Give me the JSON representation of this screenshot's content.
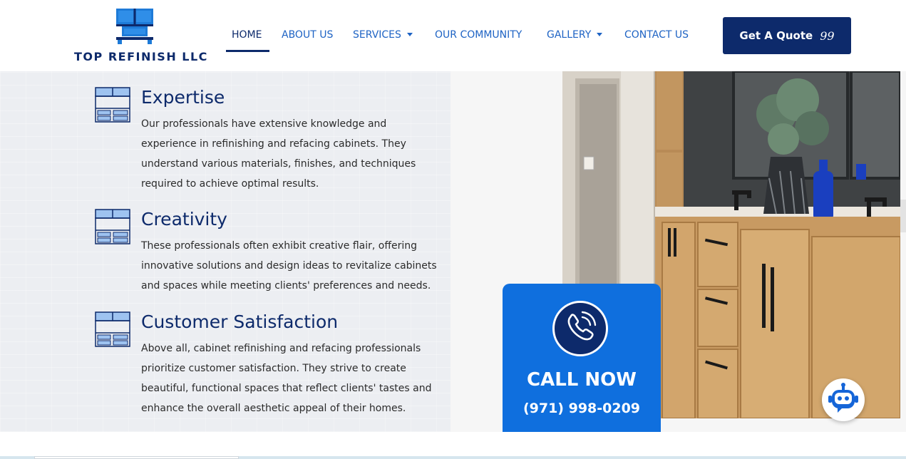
{
  "brand": {
    "name": "TOP REFINISH LLC",
    "logo_icon": "cabinet-window-icon",
    "color_primary": "#0d2a6b",
    "color_accent": "#1e63c4"
  },
  "nav": {
    "items": [
      {
        "label": "HOME",
        "active": true
      },
      {
        "label": "ABOUT US"
      },
      {
        "label": "SERVICES",
        "has_dropdown": true
      },
      {
        "label": "OUR COMMUNITY"
      },
      {
        "label": "GALLERY",
        "has_dropdown": true
      },
      {
        "label": "CONTACT US"
      }
    ],
    "cta_label": "Get A Quote",
    "cta_icon": "quote-icon",
    "cta_glyph": "99"
  },
  "features": [
    {
      "title": "Expertise",
      "icon": "cabinet-icon",
      "text": "Our professionals have extensive knowledge and experience in refinishing and refacing cabinets. They understand various materials, finishes, and techniques required to achieve optimal results."
    },
    {
      "title": "Creativity",
      "icon": "cabinet-icon",
      "text": "These professionals often exhibit creative flair, offering innovative solutions and design ideas to revitalize cabinets and spaces while meeting clients' preferences and needs."
    },
    {
      "title": "Customer Satisfaction",
      "icon": "cabinet-icon",
      "text": "Above all, cabinet refinishing and refacing professionals prioritize customer satisfaction. They strive to create beautiful, functional spaces that reflect clients' tastes and enhance the overall aesthetic appeal of their homes."
    }
  ],
  "call": {
    "title": "CALL NOW",
    "number": "(971) 998-0209",
    "icon": "phone-call-icon",
    "color": "#0f6fde"
  },
  "photo": {
    "subject": "bathroom vanity with wood cabinets"
  },
  "chatbot": {
    "icon": "robot-chat-icon"
  }
}
